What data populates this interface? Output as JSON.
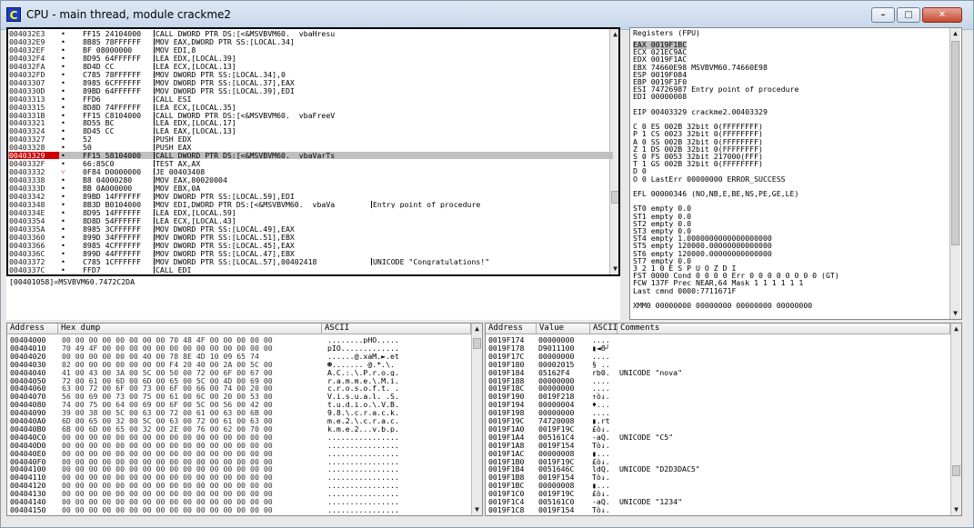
{
  "window": {
    "title": "CPU - main thread, module crackme2",
    "icon_letter": "C",
    "min_label": "–",
    "max_label": "□",
    "close_label": "✕"
  },
  "code": [
    {
      "addr": "004032E3",
      "mark": "•",
      "hex": "FF15 24104000",
      "dis": "CALL DWORD PTR DS:[<&MSVBVM60.__vbaHresu",
      "cmt": ""
    },
    {
      "addr": "004032E9",
      "mark": "•",
      "hex": "8B85 78FFFFFF",
      "dis": "MOV EAX,DWORD PTR SS:[LOCAL.34]",
      "cmt": ""
    },
    {
      "addr": "004032EF",
      "mark": "•",
      "hex": "BF 08000000",
      "dis": "MOV EDI,8",
      "cmt": ""
    },
    {
      "addr": "004032F4",
      "mark": "•",
      "hex": "8D95 64FFFFFF",
      "dis": "LEA EDX,[LOCAL.39]",
      "cmt": ""
    },
    {
      "addr": "004032FA",
      "mark": "•",
      "hex": "8D4D CC",
      "dis": "LEA ECX,[LOCAL.13]",
      "cmt": ""
    },
    {
      "addr": "004032FD",
      "mark": "•",
      "hex": "C785 78FFFFFF",
      "dis": "MOV DWORD PTR SS:[LOCAL.34],0",
      "cmt": ""
    },
    {
      "addr": "00403307",
      "mark": "•",
      "hex": "8985 6CFFFFFF",
      "dis": "MOV DWORD PTR SS:[LOCAL.37],EAX",
      "cmt": ""
    },
    {
      "addr": "0040330D",
      "mark": "•",
      "hex": "89BD 64FFFFFF",
      "dis": "MOV DWORD PTR SS:[LOCAL.39],EDI",
      "cmt": ""
    },
    {
      "addr": "00403313",
      "mark": "•",
      "hex": "FFD6",
      "dis": "CALL ESI",
      "cmt": ""
    },
    {
      "addr": "00403315",
      "mark": "•",
      "hex": "8D8D 74FFFFFF",
      "dis": "LEA ECX,[LOCAL.35]",
      "cmt": ""
    },
    {
      "addr": "0040331B",
      "mark": "•",
      "hex": "FF15 C8104000",
      "dis": "CALL DWORD PTR DS:[<&MSVBVM60.__vbaFreeV",
      "cmt": ""
    },
    {
      "addr": "00403321",
      "mark": "•",
      "hex": "8D55 BC",
      "dis": "LEA EDX,[LOCAL.17]",
      "cmt": ""
    },
    {
      "addr": "00403324",
      "mark": "•",
      "hex": "8D45 CC",
      "dis": "LEA EAX,[LOCAL.13]",
      "cmt": ""
    },
    {
      "addr": "00403327",
      "mark": "•",
      "hex": "52",
      "dis": "PUSH EDX",
      "cmt": ""
    },
    {
      "addr": "00403328",
      "mark": "•",
      "hex": "50",
      "dis": "PUSH EAX",
      "cmt": ""
    },
    {
      "addr": "00403329",
      "mark": "•",
      "hex": "FF15 58104000",
      "dis": "CALL DWORD PTR DS:[<&MSVBVM60.__vbaVarTs",
      "cmt": ""
    },
    {
      "addr": "0040332F",
      "mark": "•",
      "hex": "66:85C0",
      "dis": "TEST AX,AX",
      "cmt": ""
    },
    {
      "addr": "00403332",
      "mark": "˅",
      "hex": "0F84 D0000000",
      "dis": "JE 00403408",
      "cmt": ""
    },
    {
      "addr": "00403338",
      "mark": "•",
      "hex": "B8 04000280",
      "dis": "MOV EAX,80020004",
      "cmt": ""
    },
    {
      "addr": "0040333D",
      "mark": "•",
      "hex": "BB 0A000000",
      "dis": "MOV EBX,0A",
      "cmt": ""
    },
    {
      "addr": "00403342",
      "mark": "•",
      "hex": "89BD 14FFFFFF",
      "dis": "MOV DWORD PTR SS:[LOCAL.59],EDI",
      "cmt": ""
    },
    {
      "addr": "00403348",
      "mark": "•",
      "hex": "8B3D B0104000",
      "dis": "MOV EDI,DWORD PTR DS:[<&MSVBVM60.__vbaVa",
      "cmt": "Entry point of procedure"
    },
    {
      "addr": "0040334E",
      "mark": "•",
      "hex": "8D95 14FFFFFF",
      "dis": "LEA EDX,[LOCAL.59]",
      "cmt": ""
    },
    {
      "addr": "00403354",
      "mark": "•",
      "hex": "8D8D 54FFFFFF",
      "dis": "LEA ECX,[LOCAL.43]",
      "cmt": ""
    },
    {
      "addr": "0040335A",
      "mark": "•",
      "hex": "8985 3CFFFFFF",
      "dis": "MOV DWORD PTR SS:[LOCAL.49],EAX",
      "cmt": ""
    },
    {
      "addr": "00403360",
      "mark": "•",
      "hex": "899D 34FFFFFF",
      "dis": "MOV DWORD PTR SS:[LOCAL.51],EBX",
      "cmt": ""
    },
    {
      "addr": "00403366",
      "mark": "•",
      "hex": "8985 4CFFFFFF",
      "dis": "MOV DWORD PTR SS:[LOCAL.45],EAX",
      "cmt": ""
    },
    {
      "addr": "0040336C",
      "mark": "•",
      "hex": "899D 44FFFFFF",
      "dis": "MOV DWORD PTR SS:[LOCAL.47],EBX",
      "cmt": ""
    },
    {
      "addr": "00403372",
      "mark": "•",
      "hex": "C785 1CFFFFFF",
      "dis": "MOV DWORD PTR SS:[LOCAL.57],00402418",
      "cmt": "UNICODE \"Congratulations!\""
    },
    {
      "addr": "0040337C",
      "mark": "•",
      "hex": "FFD7",
      "dis": "CALL EDI",
      "cmt": ""
    }
  ],
  "code_selected_index": 15,
  "info": {
    "line1": "[00401058]=MSVBVM60.7472C2DA"
  },
  "registers": {
    "title": "Registers (FPU)",
    "lines": [
      "EAX 0019F1BC",
      "ECX 021EC9AC",
      "EDX 0019F1AC",
      "EBX 74660E98 MSVBVM60.74660E98",
      "ESP 0019F084",
      "EBP 0019F1F0",
      "ESI 74726987 Entry point of procedure",
      "EDI 00000008",
      "",
      "EIP 00403329 crackme2.00403329",
      "",
      "C 0  ES 002B 32bit 0(FFFFFFFF)",
      "P 1  CS 0023 32bit 0(FFFFFFFF)",
      "A 0  SS 002B 32bit 0(FFFFFFFF)",
      "Z 1  DS 002B 32bit 0(FFFFFFFF)",
      "S 0  FS 0053 32bit 217000(FFF)",
      "T 1  GS 002B 32bit 0(FFFFFFFF)",
      "D 0",
      "O 0  LastErr 00000000 ERROR_SUCCESS",
      "",
      "EFL 00000346 (NO,NB,E,BE,NS,PE,GE,LE)",
      "",
      "ST0 empty 0.0",
      "ST1 empty 0.0",
      "ST2 empty 0.0",
      "ST3 empty 0.0",
      "ST4 empty 1.0000000000000000000",
      "ST5 empty 120000.00000000000000",
      "ST6 empty 120000.00000000000000",
      "ST7 empty 0.0",
      "               3 2 1 0      E S P U O Z D I",
      "FST 0000  Cond 0 0 0 0  Err 0 0 0 0 0 0 0 0 (GT)",
      "FCW 137F  Prec NEAR,64  Mask    1 1 1 1 1 1",
      "Last cmnd 0000:7711671F",
      "",
      "XMM0 00000000 00000000 00000000 00000000"
    ]
  },
  "dump": {
    "headers": {
      "addr": "Address",
      "hex": "Hex dump",
      "ascii": "ASCII"
    },
    "rows": [
      {
        "addr": "00404000",
        "hex": "00 00 00 00 00 00 00 00 70 48 4F 00 00 00 00 00",
        "ascii": "........pHO....."
      },
      {
        "addr": "00404010",
        "hex": "70 49 4F 00 00 00 00 00 00 00 00 00 00 00 00 00",
        "ascii": "pIO............."
      },
      {
        "addr": "00404020",
        "hex": "00 00 00 00 00 00 40 00 78 8E 4D 10 09 65 74",
        "ascii": "......@.xaM.►.et"
      },
      {
        "addr": "00404030",
        "hex": "02 00 00 00 00 00 00 00 F4 20 40 00 2A 00 5C 00",
        "ascii": "☻....... @.*.\\."
      },
      {
        "addr": "00404040",
        "hex": "41 00 43 00 3A 00 5C 00 50 00 72 00 6F 00 67 00",
        "ascii": "A.C.:.\\.P.r.o.g."
      },
      {
        "addr": "00404050",
        "hex": "72 00 61 00 6D 00 6D 00 65 00 5C 00 4D 00 69 00",
        "ascii": "r.a.m.m.e.\\.M.i."
      },
      {
        "addr": "00404060",
        "hex": "63 00 72 00 6F 00 73 00 6F 00 66 00 74 00 20 00",
        "ascii": "c.r.o.s.o.f.t. ."
      },
      {
        "addr": "00404070",
        "hex": "56 00 69 00 73 00 75 00 61 00 6C 00 20 00 53 00",
        "ascii": "V.i.s.u.a.l. .S."
      },
      {
        "addr": "00404080",
        "hex": "74 00 75 00 64 00 69 00 6F 00 5C 00 56 00 42 00",
        "ascii": "t.u.d.i.o.\\.V.B."
      },
      {
        "addr": "00404090",
        "hex": "39 00 38 00 5C 00 63 00 72 00 61 00 63 00 6B 00",
        "ascii": "9.8.\\.c.r.a.c.k."
      },
      {
        "addr": "004040A0",
        "hex": "6D 00 65 00 32 00 5C 00 63 00 72 00 61 00 63 00",
        "ascii": "m.e.2.\\.c.r.a.c."
      },
      {
        "addr": "004040B0",
        "hex": "6B 00 6D 00 65 00 32 00 2E 00 76 00 62 00 70 00",
        "ascii": "k.m.e.2...v.b.p."
      },
      {
        "addr": "004040C0",
        "hex": "00 00 00 00 00 00 00 00 00 00 00 00 00 00 00 00",
        "ascii": "................"
      },
      {
        "addr": "004040D0",
        "hex": "00 00 00 00 00 00 00 00 00 00 00 00 00 00 00 00",
        "ascii": "................"
      },
      {
        "addr": "004040E0",
        "hex": "00 00 00 00 00 00 00 00 00 00 00 00 00 00 00 00",
        "ascii": "................"
      },
      {
        "addr": "004040F0",
        "hex": "00 00 00 00 00 00 00 00 00 00 00 00 00 00 00 00",
        "ascii": "................"
      },
      {
        "addr": "00404100",
        "hex": "00 00 00 00 00 00 00 00 00 00 00 00 00 00 00 00",
        "ascii": "................"
      },
      {
        "addr": "00404110",
        "hex": "00 00 00 00 00 00 00 00 00 00 00 00 00 00 00 00",
        "ascii": "................"
      },
      {
        "addr": "00404120",
        "hex": "00 00 00 00 00 00 00 00 00 00 00 00 00 00 00 00",
        "ascii": "................"
      },
      {
        "addr": "00404130",
        "hex": "00 00 00 00 00 00 00 00 00 00 00 00 00 00 00 00",
        "ascii": "................"
      },
      {
        "addr": "00404140",
        "hex": "00 00 00 00 00 00 00 00 00 00 00 00 00 00 00 00",
        "ascii": "................"
      },
      {
        "addr": "00404150",
        "hex": "00 00 00 00 00 00 00 00 00 00 00 00 00 00 00 00",
        "ascii": "................"
      }
    ]
  },
  "stack": {
    "headers": {
      "addr": "Address",
      "value": "Value",
      "ascii": "ASCII",
      "comments": "Comments"
    },
    "rows": [
      {
        "addr": "0019F174",
        "val": "00000000",
        "asc": "....",
        "cmt": ""
      },
      {
        "addr": "0019F178",
        "val": "D9011100",
        "asc": "▮◄Θ┘",
        "cmt": ""
      },
      {
        "addr": "0019F17C",
        "val": "00000000",
        "asc": "....",
        "cmt": ""
      },
      {
        "addr": "0019F180",
        "val": "00002015",
        "asc": "§ ..",
        "cmt": ""
      },
      {
        "addr": "0019F184",
        "val": "05162F4",
        "asc": "rb0.",
        "cmt": "UNICODE \"nova\""
      },
      {
        "addr": "0019F188",
        "val": "00000000",
        "asc": "....",
        "cmt": ""
      },
      {
        "addr": "0019F18C",
        "val": "00000000",
        "asc": "....",
        "cmt": ""
      },
      {
        "addr": "0019F190",
        "val": "0019F218",
        "asc": "↑ò↓.",
        "cmt": ""
      },
      {
        "addr": "0019F194",
        "val": "00000004",
        "asc": "♦...",
        "cmt": ""
      },
      {
        "addr": "0019F198",
        "val": "00000000",
        "asc": "....",
        "cmt": ""
      },
      {
        "addr": "0019F19C",
        "val": "74720008",
        "asc": "▮.rt",
        "cmt": ""
      },
      {
        "addr": "0019F1A0",
        "val": "0019F19C",
        "asc": "£ò↓.",
        "cmt": ""
      },
      {
        "addr": "0019F1A4",
        "val": "005161C4",
        "asc": "-aQ.",
        "cmt": "UNICODE \"C5\""
      },
      {
        "addr": "0019F1A8",
        "val": "0019F154",
        "asc": "Tò↓.",
        "cmt": ""
      },
      {
        "addr": "0019F1AC",
        "val": "00000008",
        "asc": "▮...",
        "cmt": ""
      },
      {
        "addr": "0019F1B0",
        "val": "0019F19C",
        "asc": "£ò↓.",
        "cmt": ""
      },
      {
        "addr": "0019F1B4",
        "val": "0051646C",
        "asc": "ldQ.",
        "cmt": "UNICODE \"D2D3DAC5\""
      },
      {
        "addr": "0019F1B8",
        "val": "0019F154",
        "asc": "Tò↓.",
        "cmt": ""
      },
      {
        "addr": "0019F1BC",
        "val": "00000008",
        "asc": "▮...",
        "cmt": ""
      },
      {
        "addr": "0019F1C0",
        "val": "0019F19C",
        "asc": "£ò↓.",
        "cmt": ""
      },
      {
        "addr": "0019F1C4",
        "val": "005161C0",
        "asc": "-aQ.",
        "cmt": "UNICODE \"1234\""
      },
      {
        "addr": "0019F1C8",
        "val": "0019F154",
        "asc": "Tò↓.",
        "cmt": ""
      }
    ]
  },
  "colors": {
    "eip_marker": "#cc0000",
    "selection": "#c0c0c0"
  }
}
